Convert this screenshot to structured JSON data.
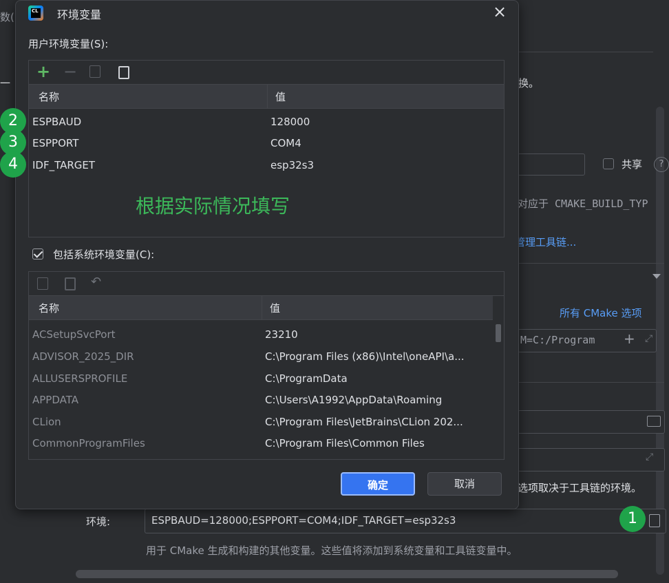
{
  "dialog": {
    "title": "环境变量",
    "user_section_label": "用户环境变量(S):",
    "user_table": {
      "columns": [
        "名称",
        "值"
      ],
      "rows": [
        {
          "name": "ESPBAUD",
          "value": "128000",
          "badge": "2"
        },
        {
          "name": "ESPPORT",
          "value": "COM4",
          "badge": "3"
        },
        {
          "name": "IDF_TARGET",
          "value": "esp32s3",
          "badge": "4"
        }
      ],
      "annotation": "根据实际情况填写"
    },
    "include_system_label": "包括系统环境变量(C):",
    "include_system_checked": true,
    "system_table": {
      "columns": [
        "名称",
        "值"
      ],
      "rows": [
        {
          "name": "ACSetupSvcPort",
          "value": "23210"
        },
        {
          "name": "ADVISOR_2025_DIR",
          "value": "C:\\Program Files (x86)\\Intel\\oneAPI\\a..."
        },
        {
          "name": "ALLUSERSPROFILE",
          "value": "C:\\ProgramData"
        },
        {
          "name": "APPDATA",
          "value": "C:\\Users\\A1992\\AppData\\Roaming"
        },
        {
          "name": "CLion",
          "value": "C:\\Program Files\\JetBrains\\CLion 202..."
        },
        {
          "name": "CommonProgramFiles",
          "value": "C:\\Program Files\\Common Files"
        }
      ]
    },
    "ok_label": "确定",
    "cancel_label": "取消"
  },
  "background": {
    "left_top_1": "数(",
    "partial_left": "一",
    "partial_right_top": "换。",
    "share_label": "共享",
    "help_glyph": "?",
    "build_type_text": "对应于 CMAKE_BUILD_TYP",
    "manage_toolchain_link": "管理工具链...",
    "all_cmake_options": "所有 CMake 选项",
    "cmake_options_value": "M=C:/Program",
    "toolchain_env_hint": "选项取决于工具链的环境。",
    "env_label": "环境:",
    "env_value": "ESPBAUD=128000;ESPPORT=COM4;IDF_TARGET=esp32s3",
    "env_badge": "1",
    "env_hint": "用于 CMake 生成和构建的其他变量。这些值将添加到系统变量和工具链变量中。"
  },
  "colors": {
    "accent_button": "#3574f0",
    "badge_green": "#1fa34a",
    "annotation_green": "#3cb95a",
    "link_blue": "#589df6"
  }
}
